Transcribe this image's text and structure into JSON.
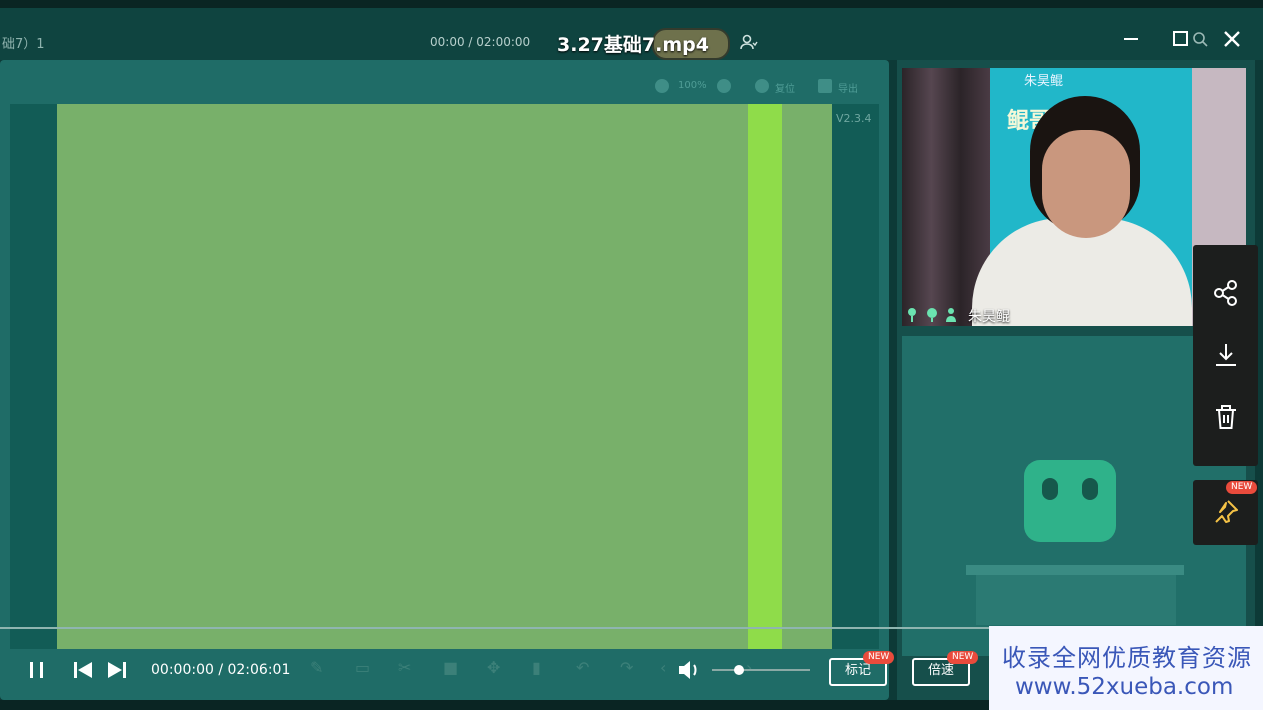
{
  "titlebar": {
    "class_title": "础7）1",
    "inner_time": "00:00 / 02:00:00",
    "file_title": "3.27基础7.mp4"
  },
  "board": {
    "toolbar": {
      "zoom": "100%",
      "reset": "复位",
      "export": "导出"
    },
    "version": "V2.3.4"
  },
  "video": {
    "poster_top": "朱昊鲲",
    "poster_text": "鲲哥  数学",
    "speaker_name": "朱昊鲲"
  },
  "player": {
    "time": "00:00:00 / 02:06:01",
    "mark_label": "标记",
    "speed_label": "倍速",
    "new_tag": "NEW"
  },
  "side_menu": {
    "pin_new_tag": "NEW"
  },
  "watermark": {
    "line1": "收录全网优质教育资源",
    "line2": "www.52xueba.com"
  },
  "colors": {
    "board_green": "#78b06a",
    "stripe_green": "#8fdc4a",
    "panel_teal": "#1f6c67",
    "watermark_text": "#3a57b8"
  }
}
